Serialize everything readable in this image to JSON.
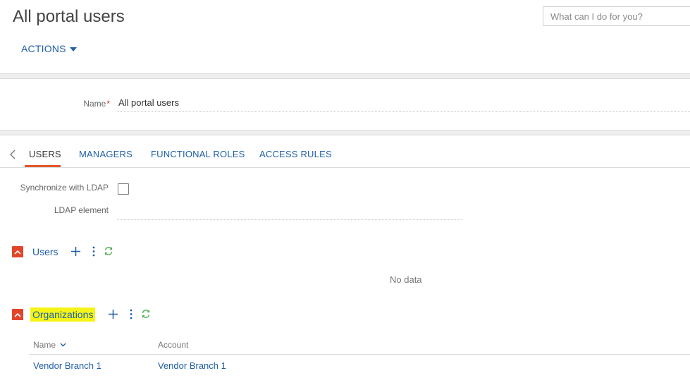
{
  "header": {
    "title": "All portal users",
    "search_placeholder": "What can I do for you?",
    "actions_label": "ACTIONS"
  },
  "form": {
    "name_label": "Name",
    "name_required_mark": "*",
    "name_value": "All portal users"
  },
  "tabs": [
    {
      "label": "USERS",
      "active": true
    },
    {
      "label": "MANAGERS",
      "active": false
    },
    {
      "label": "FUNCTIONAL ROLES",
      "active": false
    },
    {
      "label": "ACCESS RULES",
      "active": false
    }
  ],
  "ldap": {
    "sync_label": "Synchronize with LDAP",
    "sync_checked": false,
    "element_label": "LDAP element",
    "element_value": ""
  },
  "users_detail": {
    "title": "Users",
    "empty_text": "No data"
  },
  "organizations_detail": {
    "title": "Organizations",
    "highlight_color": "#f4f417",
    "columns": [
      "Name",
      "Account"
    ],
    "rows": [
      {
        "name": "Vendor Branch 1",
        "account": "Vendor Branch 1"
      }
    ]
  },
  "colors": {
    "link_blue": "#1f5fa8",
    "accent_orange": "#e2452a",
    "refresh_green": "#4caf50"
  },
  "icons": {
    "actions_caret": "caret-down-icon",
    "tabs_back": "chevron-left-icon",
    "collapse": "chevron-up-icon",
    "add": "plus-icon",
    "menu": "vertical-dots-icon",
    "refresh": "refresh-icon",
    "sort": "chevron-down-icon"
  }
}
